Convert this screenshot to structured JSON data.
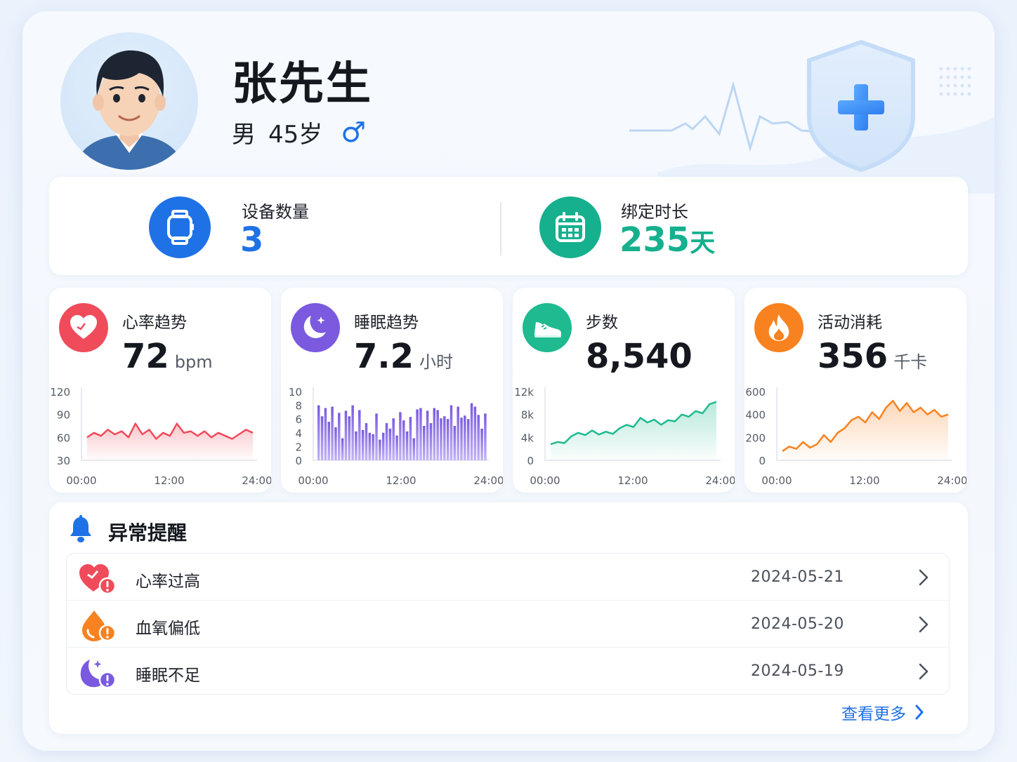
{
  "profile": {
    "name": "张先生",
    "gender": "男",
    "age": "45岁",
    "gender_symbol": "♂"
  },
  "stats": {
    "devices": {
      "label": "设备数量",
      "value": "3",
      "icon": "smartwatch-icon",
      "color": "#1e72e6"
    },
    "bind": {
      "label": "绑定时长",
      "value": "235",
      "unit": "天",
      "icon": "calendar-icon",
      "color": "#16b08e"
    }
  },
  "metrics": [
    {
      "title": "心率趋势",
      "value": "72",
      "unit": "bpm",
      "icon": "heart-icon",
      "color": "#ef4b5b"
    },
    {
      "title": "睡眠趋势",
      "value": "7.2",
      "unit": "小时",
      "icon": "moon-icon",
      "color": "#7b5ae0"
    },
    {
      "title": "步数",
      "value": "8,540",
      "unit": "",
      "icon": "sneaker-icon",
      "color": "#1fba90"
    },
    {
      "title": "活动消耗",
      "value": "356",
      "unit": "千卡",
      "icon": "flame-icon",
      "color": "#f7821f"
    }
  ],
  "chart_data": [
    {
      "type": "line",
      "title": "心率趋势",
      "x_ticks": [
        "00:00",
        "12:00",
        "24:00"
      ],
      "y_ticks": [
        "120",
        "90",
        "60",
        "30"
      ],
      "ylim": [
        30,
        120
      ],
      "x": [
        0,
        1,
        2,
        3,
        4,
        5,
        6,
        7,
        8,
        9,
        10,
        11,
        12,
        13,
        14,
        15,
        16,
        17,
        18,
        19,
        20,
        21,
        22,
        23,
        24
      ],
      "values": [
        60,
        66,
        62,
        70,
        64,
        68,
        60,
        78,
        64,
        70,
        58,
        66,
        62,
        78,
        66,
        68,
        62,
        68,
        60,
        66,
        62,
        58,
        64,
        70,
        66
      ],
      "color": "#ef4b5b"
    },
    {
      "type": "bar",
      "title": "睡眠趋势",
      "x_ticks": [
        "00:00",
        "12:00",
        "24:00"
      ],
      "y_ticks": [
        "10",
        "8",
        "6",
        "4",
        "2",
        "0"
      ],
      "ylim": [
        0,
        10
      ],
      "values": [
        8.0,
        6.4,
        7.6,
        5.6,
        7.8,
        4.8,
        6.9,
        3.2,
        7.2,
        6.4,
        8.0,
        4.2,
        7.3,
        4.4,
        5.4,
        4.0,
        3.8,
        6.8,
        3.0,
        4.0,
        5.4,
        4.6,
        6.1,
        3.6,
        7.0,
        5.8,
        4.2,
        6.3,
        3.2,
        7.4,
        7.6,
        5.0,
        7.2,
        5.4,
        7.6,
        7.3,
        6.1,
        6.4,
        6.0,
        8.0,
        5.0,
        7.8,
        6.2,
        6.5,
        6.0,
        8.3,
        7.8,
        6.6,
        4.6,
        6.8
      ],
      "color": "#8a6ef0"
    },
    {
      "type": "area",
      "title": "步数",
      "x_ticks": [
        "00:00",
        "12:00",
        "24:00"
      ],
      "y_ticks": [
        "12k",
        "8k",
        "4k",
        "0"
      ],
      "ylim": [
        0,
        12000
      ],
      "x": [
        0,
        1,
        2,
        3,
        4,
        5,
        6,
        7,
        8,
        9,
        10,
        11,
        12,
        13,
        14,
        15,
        16,
        17,
        18,
        19,
        20,
        21,
        22,
        23,
        24
      ],
      "values": [
        2800,
        3200,
        3000,
        4200,
        4800,
        4400,
        5200,
        4500,
        5000,
        4600,
        5600,
        6200,
        5800,
        7400,
        6600,
        7100,
        6200,
        7000,
        6800,
        8000,
        7600,
        8600,
        8200,
        9800,
        10200
      ],
      "color": "#1fba90"
    },
    {
      "type": "area",
      "title": "活动消耗",
      "x_ticks": [
        "00:00",
        "12:00",
        "24:00"
      ],
      "y_ticks": [
        "600",
        "400",
        "200",
        "0"
      ],
      "ylim": [
        0,
        600
      ],
      "x": [
        0,
        1,
        2,
        3,
        4,
        5,
        6,
        7,
        8,
        9,
        10,
        11,
        12,
        13,
        14,
        15,
        16,
        17,
        18,
        19,
        20,
        21,
        22,
        23,
        24
      ],
      "values": [
        80,
        120,
        100,
        160,
        110,
        140,
        220,
        160,
        240,
        280,
        350,
        380,
        330,
        420,
        360,
        460,
        520,
        430,
        500,
        420,
        460,
        400,
        440,
        380,
        400
      ],
      "color": "#f7821f"
    }
  ],
  "alerts": {
    "title": "异常提醒",
    "items": [
      {
        "label": "心率过高",
        "date": "2024-05-21",
        "icon": "heart-warning-icon",
        "color": "#ef4b5b"
      },
      {
        "label": "血氧偏低",
        "date": "2024-05-20",
        "icon": "droplet-warning-icon",
        "color": "#f7821f"
      },
      {
        "label": "睡眠不足",
        "date": "2024-05-19",
        "icon": "moon-warning-icon",
        "color": "#7b5ae0"
      }
    ],
    "more_label": "查看更多"
  }
}
